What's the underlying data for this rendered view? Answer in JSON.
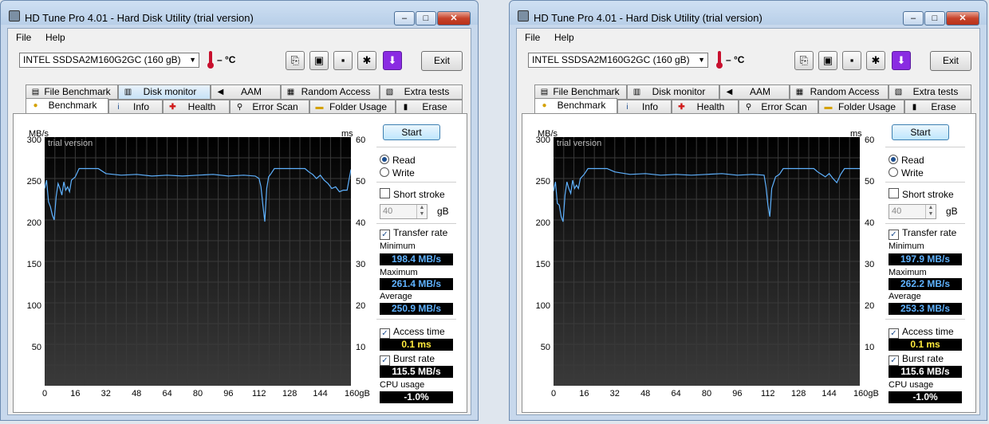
{
  "windows": [
    {
      "title": "HD Tune Pro 4.01 - Hard Disk Utility (trial version)",
      "controls": {
        "minimize": "–",
        "maximize": "□",
        "close": "✕"
      },
      "menu": [
        "File",
        "Help"
      ],
      "drive": "INTEL SSDSA2M160G2GC (160 gB)",
      "temperature": "– °C",
      "exit_label": "Exit",
      "tabs_top": [
        "File Benchmark",
        "Disk monitor",
        "AAM",
        "Random Access",
        "Extra tests"
      ],
      "tabs_bottom": [
        "Benchmark",
        "Info",
        "Health",
        "Error Scan",
        "Folder Usage",
        "Erase"
      ],
      "active_tab": "Benchmark",
      "chart": {
        "left_unit": "MB/s",
        "right_unit": "ms",
        "watermark": "trial version",
        "y_ticks": [
          "300",
          "250",
          "200",
          "150",
          "100",
          "50"
        ],
        "right_ticks": [
          "60",
          "50",
          "40",
          "30",
          "20",
          "10"
        ],
        "x_ticks": [
          "0",
          "16",
          "32",
          "48",
          "64",
          "80",
          "96",
          "112",
          "128",
          "144",
          "160gB"
        ]
      },
      "side": {
        "start_label": "Start",
        "read_label": "Read",
        "write_label": "Write",
        "read_selected": true,
        "short_stroke_label": "Short stroke",
        "short_stroke_checked": false,
        "stroke_value": "40",
        "stroke_unit": "gB",
        "transfer_rate_label": "Transfer rate",
        "transfer_rate_checked": true,
        "minimum_label": "Minimum",
        "minimum_value": "198.4 MB/s",
        "maximum_label": "Maximum",
        "maximum_value": "261.4 MB/s",
        "average_label": "Average",
        "average_value": "250.9 MB/s",
        "access_time_label": "Access time",
        "access_time_checked": true,
        "access_time_value": "0.1 ms",
        "burst_rate_label": "Burst rate",
        "burst_rate_checked": true,
        "burst_rate_value": "115.5 MB/s",
        "cpu_usage_label": "CPU usage",
        "cpu_usage_value": "-1.0%"
      }
    },
    {
      "title": "HD Tune Pro 4.01 - Hard Disk Utility (trial version)",
      "controls": {
        "minimize": "–",
        "maximize": "□",
        "close": "✕"
      },
      "menu": [
        "File",
        "Help"
      ],
      "drive": "INTEL SSDSA2M160G2GC (160 gB)",
      "temperature": "– °C",
      "exit_label": "Exit",
      "tabs_top": [
        "File Benchmark",
        "Disk monitor",
        "AAM",
        "Random Access",
        "Extra tests"
      ],
      "tabs_bottom": [
        "Benchmark",
        "Info",
        "Health",
        "Error Scan",
        "Folder Usage",
        "Erase"
      ],
      "active_tab": "Benchmark",
      "chart": {
        "left_unit": "MB/s",
        "right_unit": "ms",
        "watermark": "trial version",
        "y_ticks": [
          "300",
          "250",
          "200",
          "150",
          "100",
          "50"
        ],
        "right_ticks": [
          "60",
          "50",
          "40",
          "30",
          "20",
          "10"
        ],
        "x_ticks": [
          "0",
          "16",
          "32",
          "48",
          "64",
          "80",
          "96",
          "112",
          "128",
          "144",
          "160gB"
        ]
      },
      "side": {
        "start_label": "Start",
        "read_label": "Read",
        "write_label": "Write",
        "read_selected": true,
        "short_stroke_label": "Short stroke",
        "short_stroke_checked": false,
        "stroke_value": "40",
        "stroke_unit": "gB",
        "transfer_rate_label": "Transfer rate",
        "transfer_rate_checked": true,
        "minimum_label": "Minimum",
        "minimum_value": "197.9 MB/s",
        "maximum_label": "Maximum",
        "maximum_value": "262.2 MB/s",
        "average_label": "Average",
        "average_value": "253.3 MB/s",
        "access_time_label": "Access time",
        "access_time_checked": true,
        "access_time_value": "0.1 ms",
        "burst_rate_label": "Burst rate",
        "burst_rate_checked": true,
        "burst_rate_value": "115.6 MB/s",
        "cpu_usage_label": "CPU usage",
        "cpu_usage_value": "-1.0%"
      }
    }
  ],
  "chart_data": [
    {
      "type": "line",
      "xlim": [
        0,
        160
      ],
      "ylim": [
        0,
        300
      ],
      "y2lim": [
        0,
        60
      ],
      "grid": true,
      "series": [
        {
          "x": [
            0,
            1,
            2,
            3,
            4,
            5,
            6,
            7,
            8,
            9,
            10,
            11,
            12,
            13,
            14,
            16,
            18,
            20,
            24,
            28,
            32,
            40,
            48,
            56,
            64,
            72,
            80,
            88,
            96,
            104,
            110,
            112,
            113,
            114,
            115,
            116,
            117,
            118,
            120,
            124,
            128,
            132,
            136,
            138,
            140,
            142,
            144,
            146,
            148,
            150,
            152,
            154,
            156,
            158,
            160
          ],
          "y": [
            238,
            248,
            222,
            216,
            206,
            200,
            228,
            244,
            238,
            230,
            246,
            236,
            240,
            234,
            248,
            252,
            262,
            262,
            262,
            262,
            256,
            254,
            255,
            253,
            254,
            253,
            254,
            255,
            253,
            254,
            253,
            250,
            240,
            218,
            198,
            238,
            252,
            255,
            262,
            262,
            262,
            262,
            262,
            258,
            255,
            250,
            254,
            248,
            244,
            238,
            240,
            234,
            236,
            236,
            261
          ],
          "color": "#5fb2ff"
        }
      ]
    },
    {
      "type": "line",
      "xlim": [
        0,
        160
      ],
      "ylim": [
        0,
        300
      ],
      "y2lim": [
        0,
        60
      ],
      "grid": true,
      "series": [
        {
          "x": [
            0,
            1,
            2,
            3,
            4,
            5,
            6,
            7,
            8,
            9,
            10,
            11,
            12,
            13,
            14,
            16,
            18,
            20,
            24,
            28,
            32,
            40,
            48,
            56,
            64,
            72,
            80,
            88,
            96,
            104,
            110,
            111,
            112,
            113,
            114,
            116,
            118,
            120,
            124,
            128,
            132,
            136,
            138,
            140,
            142,
            144,
            146,
            148,
            150,
            152,
            154,
            156,
            158,
            160
          ],
          "y": [
            235,
            246,
            220,
            218,
            204,
            198,
            230,
            246,
            238,
            232,
            248,
            238,
            242,
            238,
            250,
            255,
            262,
            262,
            262,
            262,
            258,
            255,
            256,
            254,
            255,
            254,
            255,
            256,
            254,
            255,
            254,
            240,
            218,
            204,
            238,
            252,
            255,
            262,
            262,
            262,
            262,
            262,
            258,
            255,
            252,
            256,
            250,
            245,
            255,
            262,
            262,
            262,
            262,
            262
          ],
          "color": "#5fb2ff"
        }
      ]
    }
  ]
}
